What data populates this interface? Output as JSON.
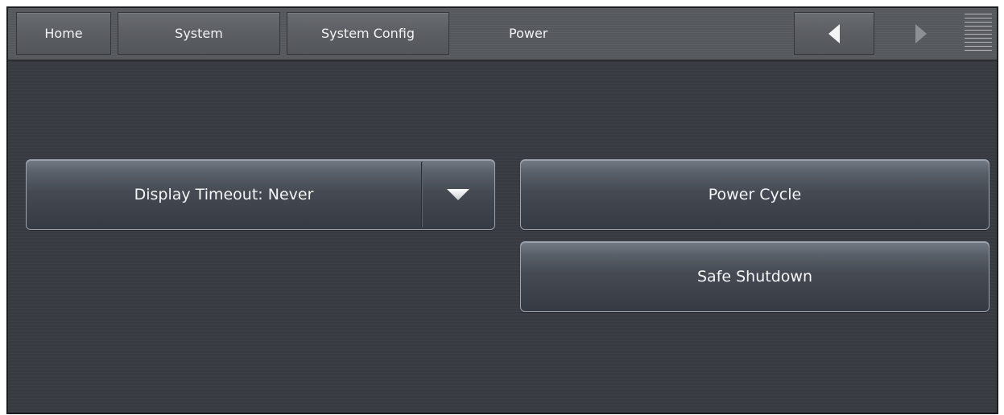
{
  "breadcrumb": {
    "home": "Home",
    "system": "System",
    "system_config": "System Config",
    "current": "Power"
  },
  "nav": {
    "back_icon": "triangle-left-icon",
    "forward_icon": "triangle-right-icon",
    "menu_icon": "menu-lines-icon"
  },
  "main": {
    "display_timeout_label": "Display Timeout: Never",
    "power_cycle_label": "Power Cycle",
    "safe_shutdown_label": "Safe Shutdown"
  },
  "colors": {
    "background": "#3a3d42",
    "button_text": "#f4f5f7",
    "button_border": "#9ea4ad"
  }
}
